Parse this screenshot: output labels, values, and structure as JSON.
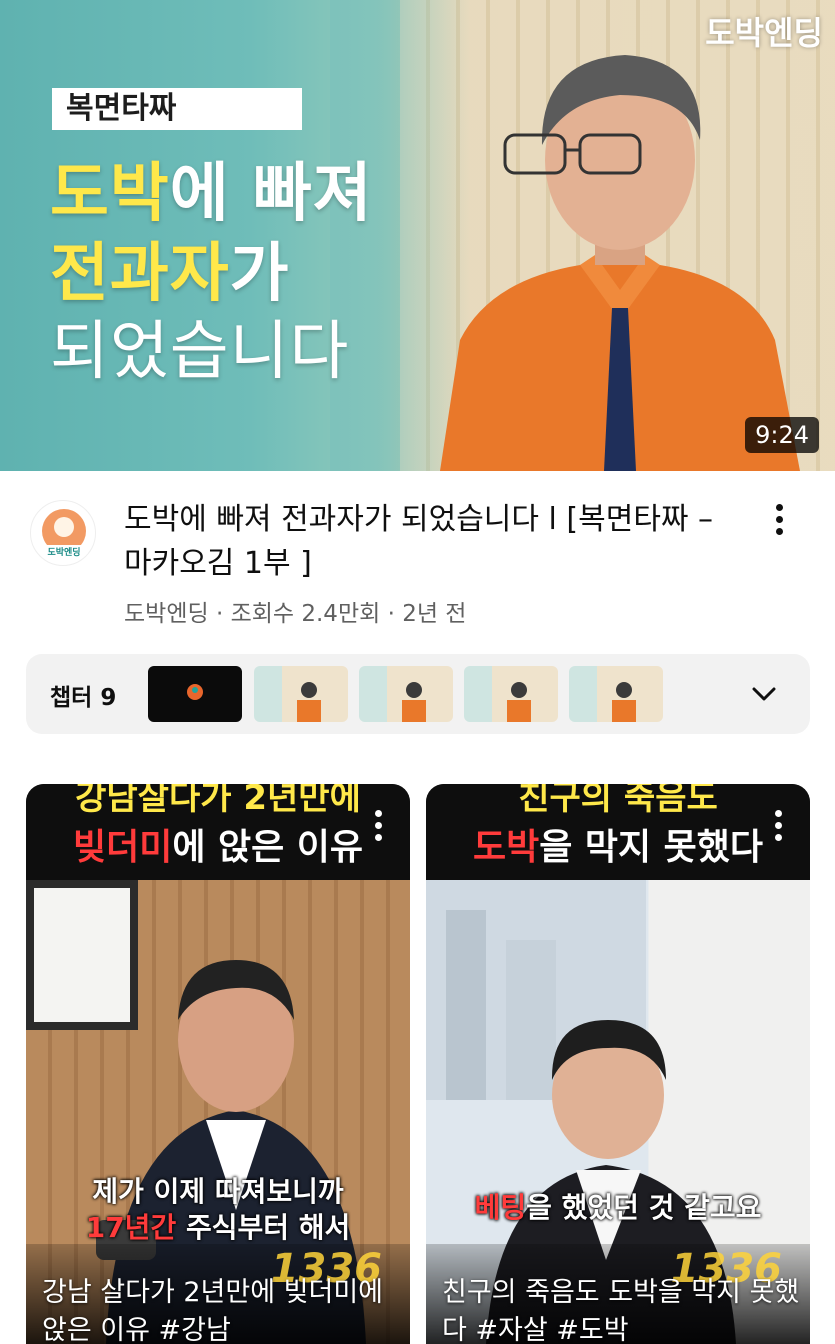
{
  "hero": {
    "tag": "복면타짜",
    "line1_hi": "도박",
    "line1_rest": "에 빠져",
    "line2_hi": "전과자",
    "line2_rest": "가",
    "line3": "되었습니다",
    "brand": "도박엔딩",
    "duration": "9:24"
  },
  "video": {
    "title": "도박에 빠져 전과자가 되었습니다 l [복면타짜 – 마카오김 1부 ]",
    "meta": "도박엔딩 · 조회수 2.4만회 · 2년 전",
    "channel_avatar_label": "도박엔딩"
  },
  "chapters": {
    "label": "챕터 9"
  },
  "shorts": [
    {
      "cap_top": "강남살다가 2년만에",
      "cap_hi": "빚더미",
      "cap_rest": "에 앉은 이유",
      "sub1": "제가 이제 따져보니까",
      "sub2_hi": "17년간",
      "sub2_rest": " 주식부터 해서",
      "number": "1336",
      "title": "강남 살다가 2년만에 빚더미에 앉은 이유 #강남"
    },
    {
      "cap_top": "친구의 죽음도",
      "cap_hi": "도박",
      "cap_rest": "을 막지 못했다",
      "sub1_hi": "베팅",
      "sub1_rest": "을 했었던 것 같고요",
      "number": "1336",
      "title": "친구의 죽음도 도박을 막지 못했다 #자살 #도박"
    }
  ]
}
